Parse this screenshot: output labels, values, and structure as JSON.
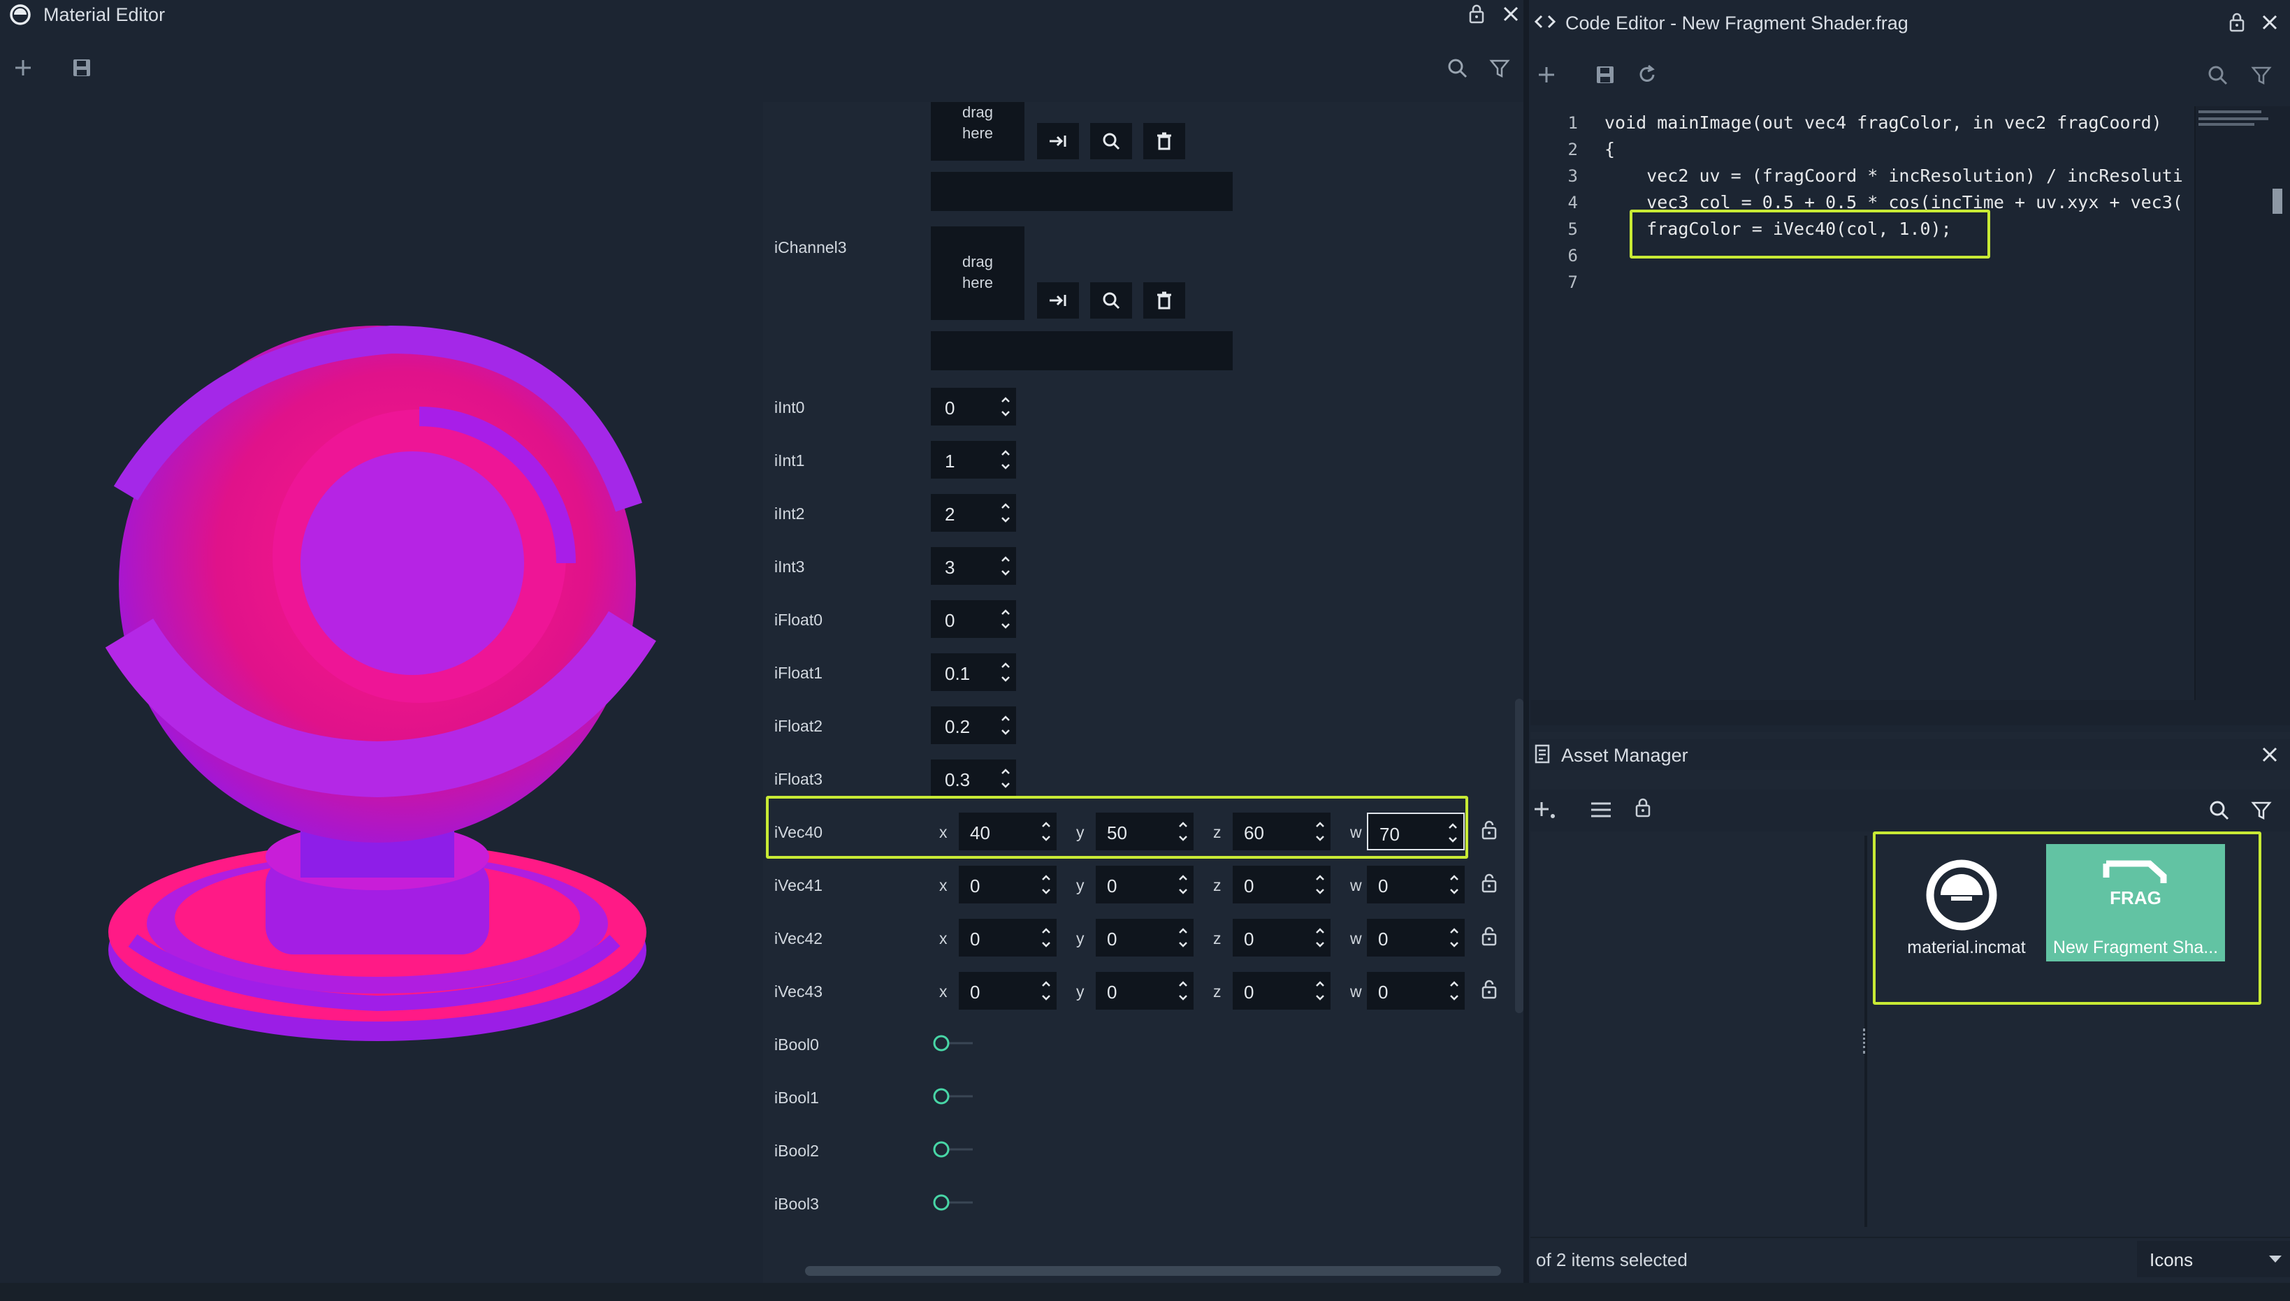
{
  "material_editor": {
    "title": "Material Editor",
    "icon": "material-editor-logo-icon",
    "toolbar": {
      "add_icon": "plus-icon",
      "save_icon": "save-icon",
      "search_icon": "search-icon",
      "filter_icon": "filter-icon"
    },
    "lock_icon": "lock-icon",
    "close_icon": "close-icon",
    "preview_colors": {
      "pink": "#ff1a8c",
      "purple": "#a020f0"
    },
    "channels": [
      {
        "name": "",
        "drop_text": "drag here"
      },
      {
        "name": "iChannel3",
        "drop_text": "drag here"
      }
    ],
    "ints": [
      {
        "label": "iInt0",
        "value": "0"
      },
      {
        "label": "iInt1",
        "value": "1"
      },
      {
        "label": "iInt2",
        "value": "2"
      },
      {
        "label": "iInt3",
        "value": "3"
      }
    ],
    "floats": [
      {
        "label": "iFloat0",
        "value": "0"
      },
      {
        "label": "iFloat1",
        "value": "0.1"
      },
      {
        "label": "iFloat2",
        "value": "0.2"
      },
      {
        "label": "iFloat3",
        "value": "0.3"
      }
    ],
    "vec_axis_labels": {
      "x": "x",
      "y": "y",
      "z": "z",
      "w": "w"
    },
    "vecs": [
      {
        "label": "iVec40",
        "x": "40",
        "y": "50",
        "z": "60",
        "w": "70"
      },
      {
        "label": "iVec41",
        "x": "0",
        "y": "0",
        "z": "0",
        "w": "0"
      },
      {
        "label": "iVec42",
        "x": "0",
        "y": "0",
        "z": "0",
        "w": "0"
      },
      {
        "label": "iVec43",
        "x": "0",
        "y": "0",
        "z": "0",
        "w": "0"
      }
    ],
    "bools": [
      {
        "label": "iBool0",
        "value": false
      },
      {
        "label": "iBool1",
        "value": false
      },
      {
        "label": "iBool2",
        "value": false
      },
      {
        "label": "iBool3",
        "value": false
      }
    ]
  },
  "code_editor": {
    "title": "Code Editor - New Fragment Shader.frag",
    "icon": "code-brackets-icon",
    "toolbar": {
      "add_icon": "plus-icon",
      "save_icon": "save-icon",
      "reload_icon": "reload-icon",
      "search_icon": "search-icon",
      "filter_icon": "filter-icon"
    },
    "lines": [
      {
        "num": "1",
        "text": "void mainImage(out vec4 fragColor, in vec2 fragCoord)"
      },
      {
        "num": "2",
        "text": "{"
      },
      {
        "num": "3",
        "text": "    vec2 uv = (fragCoord * incResolution) / incResoluti"
      },
      {
        "num": "4",
        "text": "    vec3 col = 0.5 + 0.5 * cos(incTime + uv.xyx + vec3("
      },
      {
        "num": "5",
        "text": "    fragColor = iVec40(col, 1.0);"
      },
      {
        "num": "6",
        "text": ""
      },
      {
        "num": "7",
        "text": ""
      }
    ]
  },
  "asset_manager": {
    "title": "Asset Manager",
    "icon": "asset-list-icon",
    "toolbar": {
      "add_icon": "add-icon",
      "menu_icon": "menu-icon",
      "lock_icon": "lock-icon",
      "search_icon": "search-icon",
      "filter_icon": "filter-icon"
    },
    "items": [
      {
        "name": "material.incmat",
        "icon": "material-icon",
        "selected": false
      },
      {
        "name": "New Fragment Sha...",
        "icon": "frag-file-icon",
        "icon_text": "FRAG",
        "selected": true
      }
    ],
    "status": "of 2 items selected",
    "view_mode": "Icons"
  }
}
